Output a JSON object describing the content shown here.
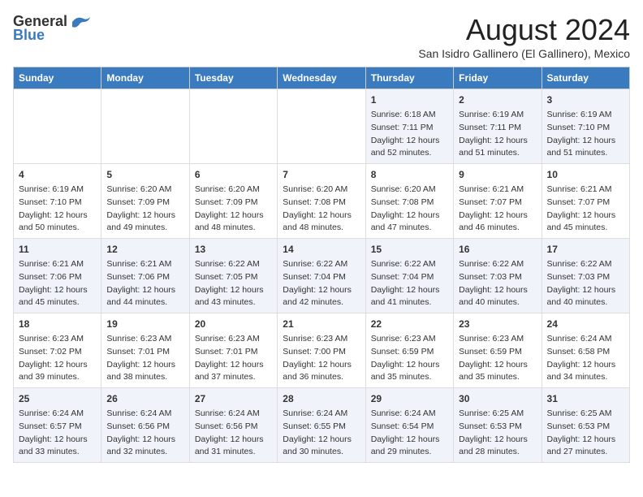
{
  "header": {
    "logo_general": "General",
    "logo_blue": "Blue",
    "month_title": "August 2024",
    "subtitle": "San Isidro Gallinero (El Gallinero), Mexico"
  },
  "weekdays": [
    "Sunday",
    "Monday",
    "Tuesday",
    "Wednesday",
    "Thursday",
    "Friday",
    "Saturday"
  ],
  "weeks": [
    [
      {
        "day": "",
        "content": ""
      },
      {
        "day": "",
        "content": ""
      },
      {
        "day": "",
        "content": ""
      },
      {
        "day": "",
        "content": ""
      },
      {
        "day": "1",
        "content": "Sunrise: 6:18 AM\nSunset: 7:11 PM\nDaylight: 12 hours\nand 52 minutes."
      },
      {
        "day": "2",
        "content": "Sunrise: 6:19 AM\nSunset: 7:11 PM\nDaylight: 12 hours\nand 51 minutes."
      },
      {
        "day": "3",
        "content": "Sunrise: 6:19 AM\nSunset: 7:10 PM\nDaylight: 12 hours\nand 51 minutes."
      }
    ],
    [
      {
        "day": "4",
        "content": "Sunrise: 6:19 AM\nSunset: 7:10 PM\nDaylight: 12 hours\nand 50 minutes."
      },
      {
        "day": "5",
        "content": "Sunrise: 6:20 AM\nSunset: 7:09 PM\nDaylight: 12 hours\nand 49 minutes."
      },
      {
        "day": "6",
        "content": "Sunrise: 6:20 AM\nSunset: 7:09 PM\nDaylight: 12 hours\nand 48 minutes."
      },
      {
        "day": "7",
        "content": "Sunrise: 6:20 AM\nSunset: 7:08 PM\nDaylight: 12 hours\nand 48 minutes."
      },
      {
        "day": "8",
        "content": "Sunrise: 6:20 AM\nSunset: 7:08 PM\nDaylight: 12 hours\nand 47 minutes."
      },
      {
        "day": "9",
        "content": "Sunrise: 6:21 AM\nSunset: 7:07 PM\nDaylight: 12 hours\nand 46 minutes."
      },
      {
        "day": "10",
        "content": "Sunrise: 6:21 AM\nSunset: 7:07 PM\nDaylight: 12 hours\nand 45 minutes."
      }
    ],
    [
      {
        "day": "11",
        "content": "Sunrise: 6:21 AM\nSunset: 7:06 PM\nDaylight: 12 hours\nand 45 minutes."
      },
      {
        "day": "12",
        "content": "Sunrise: 6:21 AM\nSunset: 7:06 PM\nDaylight: 12 hours\nand 44 minutes."
      },
      {
        "day": "13",
        "content": "Sunrise: 6:22 AM\nSunset: 7:05 PM\nDaylight: 12 hours\nand 43 minutes."
      },
      {
        "day": "14",
        "content": "Sunrise: 6:22 AM\nSunset: 7:04 PM\nDaylight: 12 hours\nand 42 minutes."
      },
      {
        "day": "15",
        "content": "Sunrise: 6:22 AM\nSunset: 7:04 PM\nDaylight: 12 hours\nand 41 minutes."
      },
      {
        "day": "16",
        "content": "Sunrise: 6:22 AM\nSunset: 7:03 PM\nDaylight: 12 hours\nand 40 minutes."
      },
      {
        "day": "17",
        "content": "Sunrise: 6:22 AM\nSunset: 7:03 PM\nDaylight: 12 hours\nand 40 minutes."
      }
    ],
    [
      {
        "day": "18",
        "content": "Sunrise: 6:23 AM\nSunset: 7:02 PM\nDaylight: 12 hours\nand 39 minutes."
      },
      {
        "day": "19",
        "content": "Sunrise: 6:23 AM\nSunset: 7:01 PM\nDaylight: 12 hours\nand 38 minutes."
      },
      {
        "day": "20",
        "content": "Sunrise: 6:23 AM\nSunset: 7:01 PM\nDaylight: 12 hours\nand 37 minutes."
      },
      {
        "day": "21",
        "content": "Sunrise: 6:23 AM\nSunset: 7:00 PM\nDaylight: 12 hours\nand 36 minutes."
      },
      {
        "day": "22",
        "content": "Sunrise: 6:23 AM\nSunset: 6:59 PM\nDaylight: 12 hours\nand 35 minutes."
      },
      {
        "day": "23",
        "content": "Sunrise: 6:23 AM\nSunset: 6:59 PM\nDaylight: 12 hours\nand 35 minutes."
      },
      {
        "day": "24",
        "content": "Sunrise: 6:24 AM\nSunset: 6:58 PM\nDaylight: 12 hours\nand 34 minutes."
      }
    ],
    [
      {
        "day": "25",
        "content": "Sunrise: 6:24 AM\nSunset: 6:57 PM\nDaylight: 12 hours\nand 33 minutes."
      },
      {
        "day": "26",
        "content": "Sunrise: 6:24 AM\nSunset: 6:56 PM\nDaylight: 12 hours\nand 32 minutes."
      },
      {
        "day": "27",
        "content": "Sunrise: 6:24 AM\nSunset: 6:56 PM\nDaylight: 12 hours\nand 31 minutes."
      },
      {
        "day": "28",
        "content": "Sunrise: 6:24 AM\nSunset: 6:55 PM\nDaylight: 12 hours\nand 30 minutes."
      },
      {
        "day": "29",
        "content": "Sunrise: 6:24 AM\nSunset: 6:54 PM\nDaylight: 12 hours\nand 29 minutes."
      },
      {
        "day": "30",
        "content": "Sunrise: 6:25 AM\nSunset: 6:53 PM\nDaylight: 12 hours\nand 28 minutes."
      },
      {
        "day": "31",
        "content": "Sunrise: 6:25 AM\nSunset: 6:53 PM\nDaylight: 12 hours\nand 27 minutes."
      }
    ]
  ]
}
